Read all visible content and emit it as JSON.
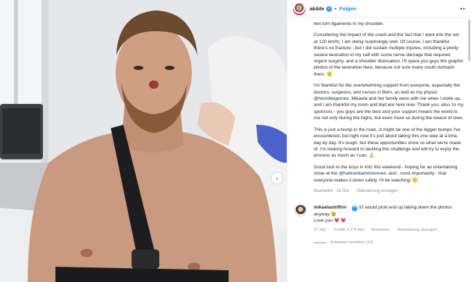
{
  "post": {
    "username": "akilde",
    "follow_label": "Folgen",
    "separator": "•",
    "more_label": "••",
    "paragraphs": {
      "p0": "two torn ligaments in my shoulder.",
      "p1": "Considering the impact of the crash and the fact that I went into the net at 120 km/hr, I am doing surprisingly well. Of course, I am thankful there's no fracture - but I did sustain multiple injuries, including a pretty severe laceration in my calf with some nerve damage that required urgent surgery, and a shoulder dislocation. I'll spare you guys the graphic photos of the laceration here, because not sure many could stomach them. 🙂",
      "p2a": "I'm thankful for the overwhelming support from everyone, especially the doctors, surgeons, and nurses in Bern, as well as my physio ",
      "p2_link": "@henriklegernes",
      "p2b": ". Mikaela and her family were with me when I woke up, and I am thankful my mom and dad are here now. Thank you, also, to my sponsors - you guys are the best and your support means the world to me not only during the highs, but even more so during the lowest of lows.",
      "p3": "This is just a bump in the road...it might be one of the bigger bumps I've encountered, but right now it's just about taking this one step at a time, day by day. It's tough, but these opportunities show us what we're made of. I'm looking forward to tackling this challenge and will try to enjoy the process as much as I can. 🙏",
      "p4a": "Good luck to the boys in Kitz this weekend - hoping for an entertaining show at the ",
      "p4_link": "@hahnenkammrennen",
      "p4b": ", and - most importantly - that everyone makes it down safely. I'll be watching! 🙂"
    },
    "meta": {
      "edited": "Bearbeitet · 18 Std.",
      "translate": "Übersetzung anzeigen"
    }
  },
  "comment": {
    "username": "mikaelashiffrin",
    "text": "IG would prob end up taking down the photos anyway",
    "text_emoji": "😉",
    "text2": "Love you",
    "text2_emoji": "💗 💗",
    "time": "17 Std.",
    "likes": "Gefällt 2.174 Mal",
    "reply": "Antworten",
    "translate": "Übersetzung anzeigen",
    "view_replies": "Antworten ansehen (10)"
  },
  "photo": {
    "next_arrow": "›"
  },
  "icons": {
    "verified": "verified-badge-icon",
    "next": "chevron-right-icon"
  },
  "colors": {
    "link": "#00376b",
    "follow": "#0095f6",
    "verified": "#3897f0",
    "muted": "#8e8e8e"
  }
}
